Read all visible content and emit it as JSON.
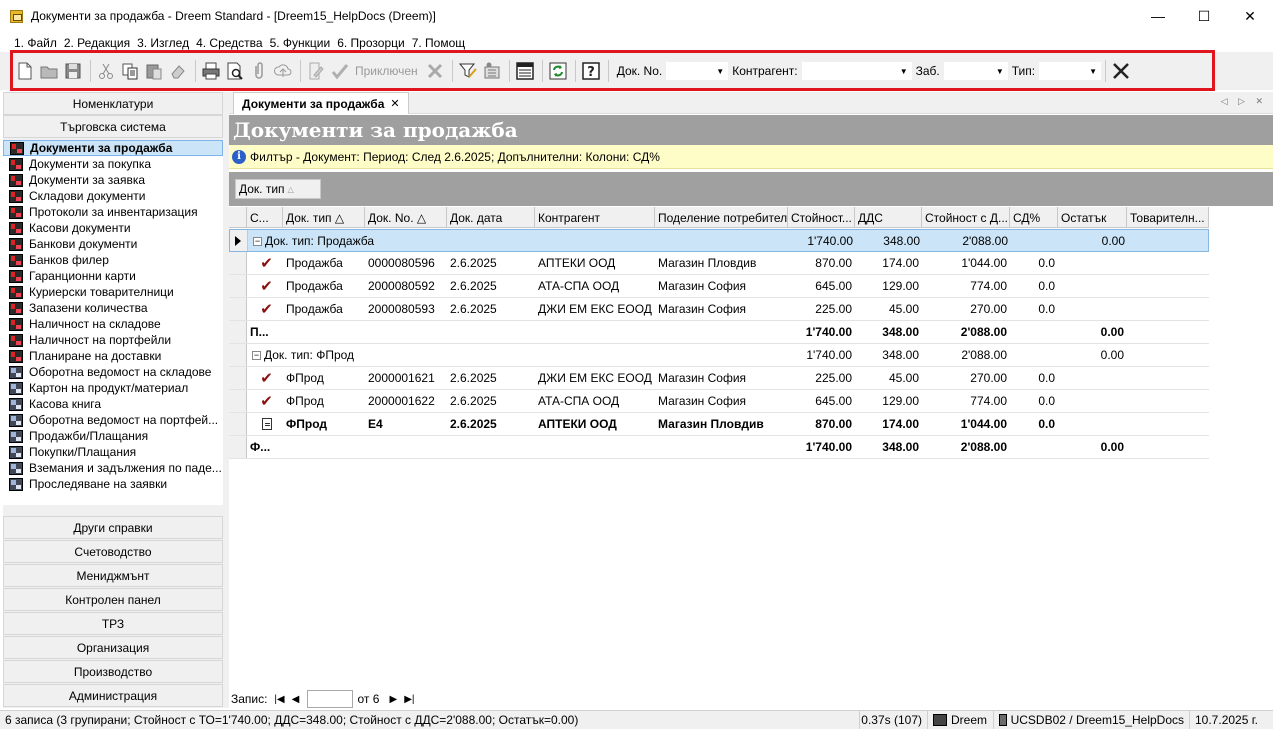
{
  "window": {
    "title": "Документи за продажба - Dreem Standard - [Dreem15_HelpDocs (Dreem)]",
    "minimize": "—",
    "maximize": "☐",
    "close": "✕"
  },
  "menu": [
    "1. Файл",
    "2. Редакция",
    "3. Изглед",
    "4. Средства",
    "5. Функции",
    "6. Прозорци",
    "7. Помощ"
  ],
  "toolbar": {
    "close_doc_label": "Приключен",
    "doc_no_label": "Док. No.",
    "partner_label": "Контрагент:",
    "note_label": "Заб.",
    "type_label": "Тип:",
    "highlight_color": "#e0161e"
  },
  "sidebar": {
    "top_sections": [
      "Номенклатури",
      "Търговска система"
    ],
    "items": [
      {
        "label": "Документи за продажба",
        "icon": "red",
        "selected": true
      },
      {
        "label": "Документи за покупка",
        "icon": "red"
      },
      {
        "label": "Документи за заявка",
        "icon": "red"
      },
      {
        "label": "Складови документи",
        "icon": "red"
      },
      {
        "label": "Протоколи за инвентаризация",
        "icon": "red"
      },
      {
        "label": "Касови документи",
        "icon": "red"
      },
      {
        "label": "Банкови документи",
        "icon": "red"
      },
      {
        "label": "Банков филер",
        "icon": "red"
      },
      {
        "label": "Гаранционни карти",
        "icon": "red"
      },
      {
        "label": "Куриерски товарителници",
        "icon": "red"
      },
      {
        "label": "Запазени количества",
        "icon": "red"
      },
      {
        "label": "Наличност на складове",
        "icon": "red"
      },
      {
        "label": "Наличност на портфейли",
        "icon": "red"
      },
      {
        "label": "Планиране на доставки",
        "icon": "red"
      },
      {
        "label": "Оборотна ведомост на складове",
        "icon": "blue"
      },
      {
        "label": "Картон на продукт/материал",
        "icon": "blue"
      },
      {
        "label": "Касова книга",
        "icon": "blue"
      },
      {
        "label": "Оборотна ведомост на портфей...",
        "icon": "blue"
      },
      {
        "label": "Продажби/Плащания",
        "icon": "blue"
      },
      {
        "label": "Покупки/Плащания",
        "icon": "blue"
      },
      {
        "label": "Вземания и задължения по паде...",
        "icon": "blue"
      },
      {
        "label": "Проследяване на заявки",
        "icon": "blue"
      }
    ],
    "bottom_sections": [
      "Други справки",
      "Счетоводство",
      "Мениджмънт",
      "Контролен панел",
      "ТРЗ",
      "Организация",
      "Производство",
      "Администрация"
    ]
  },
  "tab": {
    "label": "Документи за продажба",
    "close": "✕",
    "nav": "◁ ▷ ✕"
  },
  "page": {
    "title": "Документи за продажба",
    "filter_icon": "i",
    "filter": "Филтър - Документ: Период: След 2.6.2025; Допълнителни: Колони: СД%",
    "group_chip": "Док. тип",
    "group_chip_sort": "△"
  },
  "grid": {
    "headers": [
      "С...",
      "Док. тип △",
      "Док. No. △",
      "Док. дата",
      "Контрагент",
      "Поделение потребител",
      "Стойност...",
      "ДДС",
      "Стойност с Д...",
      "СД%",
      "Остатък",
      "Товарителн..."
    ],
    "groups": [
      {
        "label": "Док. тип: Продажба",
        "expander": "−",
        "value": "1'740.00",
        "vat": "348.00",
        "total": "2'088.00",
        "rest": "0.00",
        "rows": [
          {
            "type": "Продажба",
            "no": "0000080596",
            "date": "2.6.2025",
            "partner": "АПТЕКИ ООД",
            "division": "Магазин Пловдив",
            "value": "870.00",
            "vat": "174.00",
            "total": "1'044.00",
            "sd": "0.0",
            "status_icon": "✔"
          },
          {
            "type": "Продажба",
            "no": "2000080592",
            "date": "2.6.2025",
            "partner": "АТА-СПА ООД",
            "division": "Магазин София",
            "value": "645.00",
            "vat": "129.00",
            "total": "774.00",
            "sd": "0.0",
            "status_icon": "✔"
          },
          {
            "type": "Продажба",
            "no": "2000080593",
            "date": "2.6.2025",
            "partner": "ДЖИ ЕМ ЕКС ЕООД",
            "division": "Магазин София",
            "value": "225.00",
            "vat": "45.00",
            "total": "270.00",
            "sd": "0.0",
            "status_icon": "✔"
          }
        ],
        "footer": {
          "label": "П...",
          "value": "1'740.00",
          "vat": "348.00",
          "total": "2'088.00",
          "rest": "0.00"
        }
      },
      {
        "label": "Док. тип: ФПрод",
        "expander": "−",
        "value": "1'740.00",
        "vat": "348.00",
        "total": "2'088.00",
        "rest": "0.00",
        "rows": [
          {
            "type": "ФПрод",
            "no": "2000001621",
            "date": "2.6.2025",
            "partner": "ДЖИ ЕМ ЕКС ЕООД",
            "division": "Магазин София",
            "value": "225.00",
            "vat": "45.00",
            "total": "270.00",
            "sd": "0.0",
            "status_icon": "✔"
          },
          {
            "type": "ФПрод",
            "no": "2000001622",
            "date": "2.6.2025",
            "partner": "АТА-СПА ООД",
            "division": "Магазин София",
            "value": "645.00",
            "vat": "129.00",
            "total": "774.00",
            "sd": "0.0",
            "status_icon": "✔"
          },
          {
            "type": "ФПрод",
            "no": "Е4",
            "date": "2.6.2025",
            "partner": "АПТЕКИ ООД",
            "division": "Магазин Пловдив",
            "value": "870.00",
            "vat": "174.00",
            "total": "1'044.00",
            "sd": "0.0",
            "status_icon": "doc",
            "bold": true
          }
        ],
        "footer": {
          "label": "Ф...",
          "value": "1'740.00",
          "vat": "348.00",
          "total": "2'088.00",
          "rest": "0.00"
        }
      }
    ]
  },
  "navigator": {
    "label": "Запис:",
    "of": "от 6",
    "first": "|◀",
    "prev": "◀",
    "next": "▶",
    "last": "▶|"
  },
  "status": {
    "summary": "6 записа (3 групирани; Стойност с ТО=1'740.00; ДДС=348.00; Стойност с ДДС=2'088.00; Остатък=0.00)",
    "timing": "0.37s (107)",
    "user": "Dreem",
    "db": "UCSDB02 / Dreem15_HelpDocs",
    "date": "10.7.2025 г."
  }
}
